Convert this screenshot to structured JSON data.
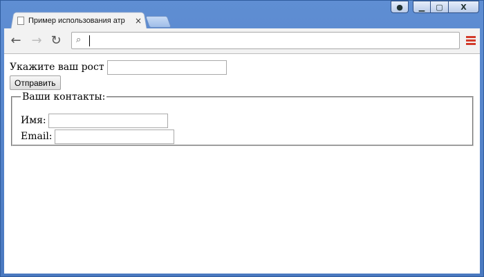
{
  "browser": {
    "tab_title": "Пример использования атр",
    "tab_close": "×",
    "window_buttons": {
      "user": "●",
      "min": "▁",
      "max": "▢",
      "close": "X"
    },
    "nav": {
      "back": "←",
      "forward": "→",
      "reload": "↻"
    },
    "omnibox": {
      "search_icon": "⌕",
      "value": ""
    }
  },
  "page": {
    "height_label": "Укажите ваш рост",
    "height_value": "",
    "submit_label": "Отправить",
    "contacts_legend": "Ваши контакты:",
    "name_label": "Имя:",
    "name_value": "",
    "email_label": "Email:",
    "email_value": ""
  },
  "colors": {
    "menu_accent": "#d23a2a",
    "frame": "#5f8ed3"
  }
}
